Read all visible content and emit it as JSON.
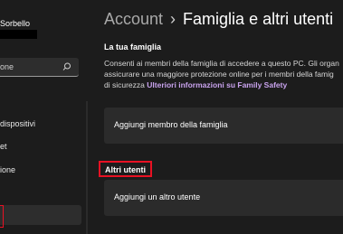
{
  "sidebar": {
    "user_name": "Sorbello",
    "search": {
      "value": "one",
      "icon": "search-icon"
    },
    "items": [
      {
        "label": "dispositivi"
      },
      {
        "label": "et"
      },
      {
        "label": "ione"
      }
    ]
  },
  "breadcrumb": {
    "parent": "Account",
    "separator": "›",
    "current": "Famiglia e altri utenti"
  },
  "family": {
    "title": "La tua famiglia",
    "description_line1": "Consenti ai membri della famiglia di accedere a questo PC. Gli organ",
    "description_line2": "assicurare una maggiore protezione online per i membri della famig",
    "description_line3_prefix": "di sicurezza",
    "link_text": "Ulteriori informazioni su Family Safety",
    "add_member_label": "Aggiungi membro della famiglia"
  },
  "others": {
    "title": "Altri utenti",
    "add_user_label": "Aggiungi un altro utente"
  },
  "colors": {
    "background": "#1c1c1c",
    "card": "#2b2b2b",
    "link": "#c9a3ee",
    "highlight": "#e81123"
  }
}
